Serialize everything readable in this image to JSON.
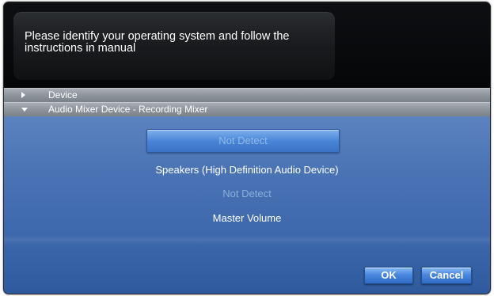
{
  "message": {
    "text": "Please identify your operating system and follow the instructions in manual"
  },
  "sections": {
    "device_label": "Device",
    "mixer_label": "Audio Mixer Device - Recording Mixer"
  },
  "mixer": {
    "selected_value": "Not Detect",
    "device_line": "Speakers (High Definition Audio Device)",
    "status_line": "Not Detect",
    "volume_line": "Master Volume"
  },
  "buttons": {
    "ok": "OK",
    "cancel": "Cancel"
  },
  "colors": {
    "panel_blue": "#4a74b5",
    "header_gray": "#8e949c",
    "button_blue": "#4a88df"
  }
}
